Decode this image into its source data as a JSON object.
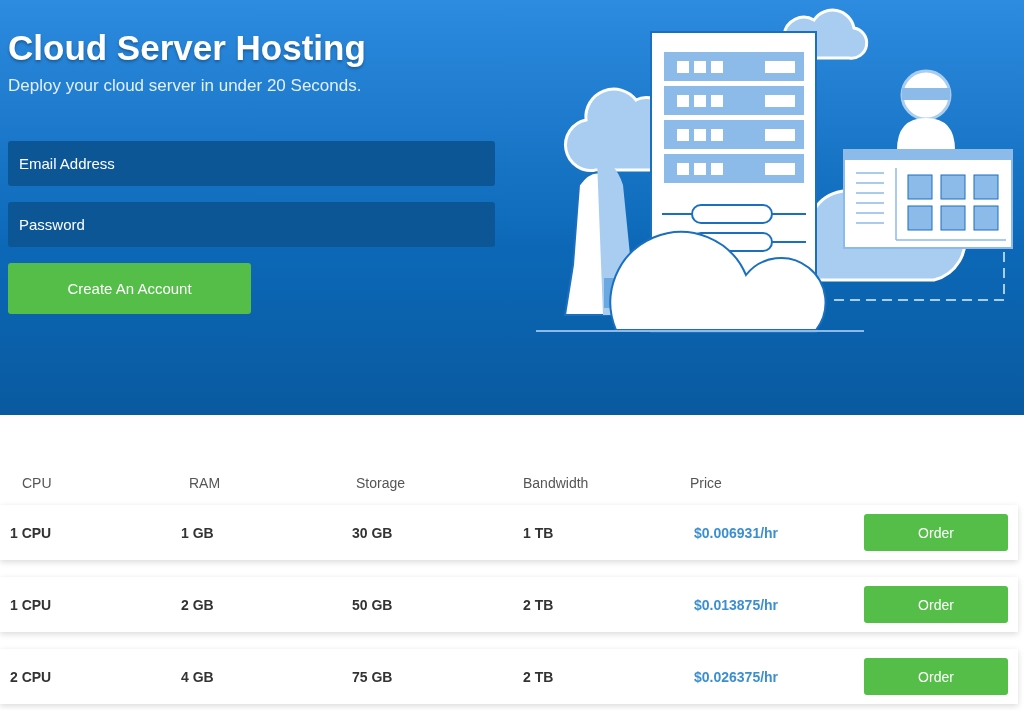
{
  "hero": {
    "title": "Cloud Server Hosting",
    "subtitle": "Deploy your cloud server in under 20 Seconds.",
    "fields": [
      {
        "placeholder": "Email Address"
      },
      {
        "placeholder": "Password"
      }
    ],
    "submit_button": "Create An Account"
  },
  "table": {
    "columns": [
      "CPU",
      "RAM",
      "Storage",
      "Bandwidth",
      "Price"
    ],
    "rows": [
      {
        "cpu": "1 CPU",
        "ram": "1 GB",
        "storage": "30 GB",
        "bandwidth": "1 TB",
        "price": "$0.006931/hr",
        "action": "Order"
      },
      {
        "cpu": "1 CPU",
        "ram": "2 GB",
        "storage": "50 GB",
        "bandwidth": "2 TB",
        "price": "$0.013875/hr",
        "action": "Order"
      },
      {
        "cpu": "2 CPU",
        "ram": "4 GB",
        "storage": "75 GB",
        "bandwidth": "2 TB",
        "price": "$0.026375/hr",
        "action": "Order"
      }
    ]
  }
}
